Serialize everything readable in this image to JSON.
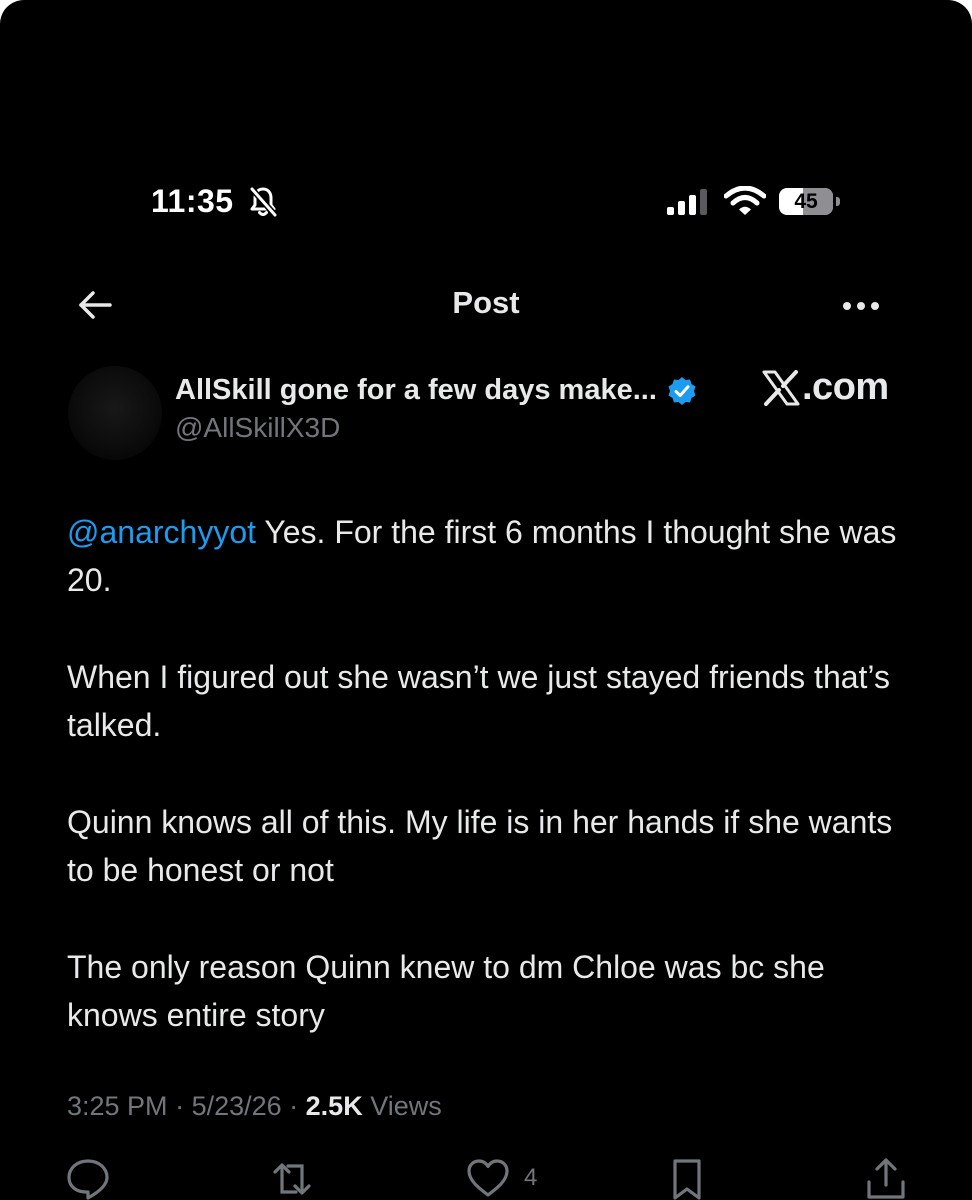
{
  "status_bar": {
    "time": "11:35",
    "battery_level": "45",
    "icons": [
      "bell-off-icon",
      "signal-icon",
      "wifi-icon",
      "battery-icon"
    ]
  },
  "header": {
    "back_icon": "arrow-left-icon",
    "title": "Post",
    "more_icon": "more-horizontal-icon"
  },
  "author": {
    "name": "AllSkill gone for a few days make...",
    "handle": "@AllSkillX3D",
    "verified": true
  },
  "watermark": {
    "text": ".com"
  },
  "post": {
    "mention": "@anarchyyot",
    "paragraph_1_rest": " Yes. For the first 6 months I thought she was 20.",
    "paragraph_2": "When I figured out she wasn’t we just stayed friends that’s talked.",
    "paragraph_3": "Quinn knows all of this. My life is in her hands if she wants to be honest or not",
    "paragraph_4": "The only reason Quinn knew to dm Chloe was bc she knows entire story"
  },
  "meta": {
    "time": "3:25 PM",
    "date": "5/23/26",
    "views_count": "2.5K",
    "views_label": "Views",
    "separator": " · "
  },
  "actions": {
    "like_count": "4",
    "icons": [
      "reply-icon",
      "repost-icon",
      "heart-icon",
      "bookmark-icon",
      "share-icon"
    ]
  },
  "colors": {
    "background": "#000000",
    "text_primary": "#e7e9ea",
    "text_secondary": "#71767b",
    "accent_blue": "#1d9bf0"
  }
}
